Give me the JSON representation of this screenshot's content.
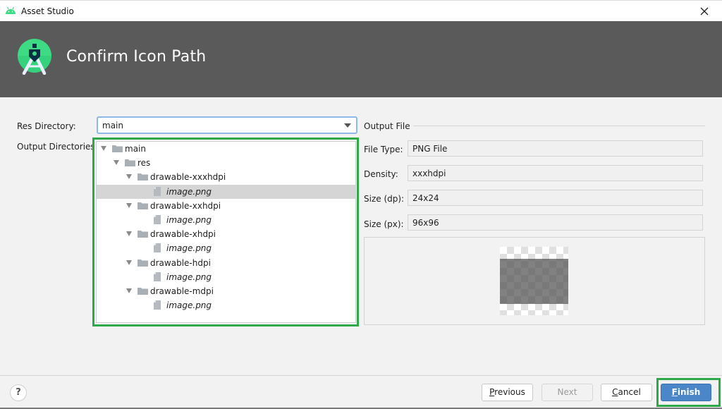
{
  "window": {
    "title": "Asset Studio",
    "app_icon": "android-icon",
    "close_icon": "close-icon"
  },
  "header": {
    "title": "Confirm Icon Path",
    "logo": "android-studio-logo"
  },
  "form": {
    "res_directory_label": "Res Directory:",
    "res_directory_value": "main",
    "output_directories_label": "Output Directories:"
  },
  "tree": [
    {
      "label": "main",
      "type": "folder",
      "depth": 0,
      "expanded": true,
      "selected": false
    },
    {
      "label": "res",
      "type": "folder",
      "depth": 1,
      "expanded": true,
      "selected": false
    },
    {
      "label": "drawable-xxxhdpi",
      "type": "folder",
      "depth": 2,
      "expanded": true,
      "selected": false
    },
    {
      "label": "image.png",
      "type": "file",
      "depth": 3,
      "selected": true
    },
    {
      "label": "drawable-xxhdpi",
      "type": "folder",
      "depth": 2,
      "expanded": true,
      "selected": false
    },
    {
      "label": "image.png",
      "type": "file",
      "depth": 3,
      "selected": false
    },
    {
      "label": "drawable-xhdpi",
      "type": "folder",
      "depth": 2,
      "expanded": true,
      "selected": false
    },
    {
      "label": "image.png",
      "type": "file",
      "depth": 3,
      "selected": false
    },
    {
      "label": "drawable-hdpi",
      "type": "folder",
      "depth": 2,
      "expanded": true,
      "selected": false
    },
    {
      "label": "image.png",
      "type": "file",
      "depth": 3,
      "selected": false
    },
    {
      "label": "drawable-mdpi",
      "type": "folder",
      "depth": 2,
      "expanded": true,
      "selected": false
    },
    {
      "label": "image.png",
      "type": "file",
      "depth": 3,
      "selected": false
    }
  ],
  "output_file": {
    "section_title": "Output File",
    "fields": [
      {
        "label": "File Type:",
        "value": "PNG File"
      },
      {
        "label": "Density:",
        "value": "xxxhdpi"
      },
      {
        "label": "Size (dp):",
        "value": "24x24"
      },
      {
        "label": "Size (px):",
        "value": "96x96"
      }
    ]
  },
  "footer": {
    "help_label": "?",
    "buttons": {
      "previous": {
        "mnemonic": "P",
        "rest": "revious",
        "enabled": true
      },
      "next": {
        "label": "Next",
        "enabled": false
      },
      "cancel": {
        "mnemonic": "C",
        "rest": "ancel",
        "enabled": true
      },
      "finish": {
        "mnemonic": "F",
        "rest": "inish",
        "enabled": true
      }
    }
  },
  "colors": {
    "header_bg": "#5a5a5a",
    "highlight_green": "#2ea94a",
    "primary_button": "#4a86c8",
    "android_green": "#3ddc84",
    "focus_border": "#8fb8ea"
  }
}
